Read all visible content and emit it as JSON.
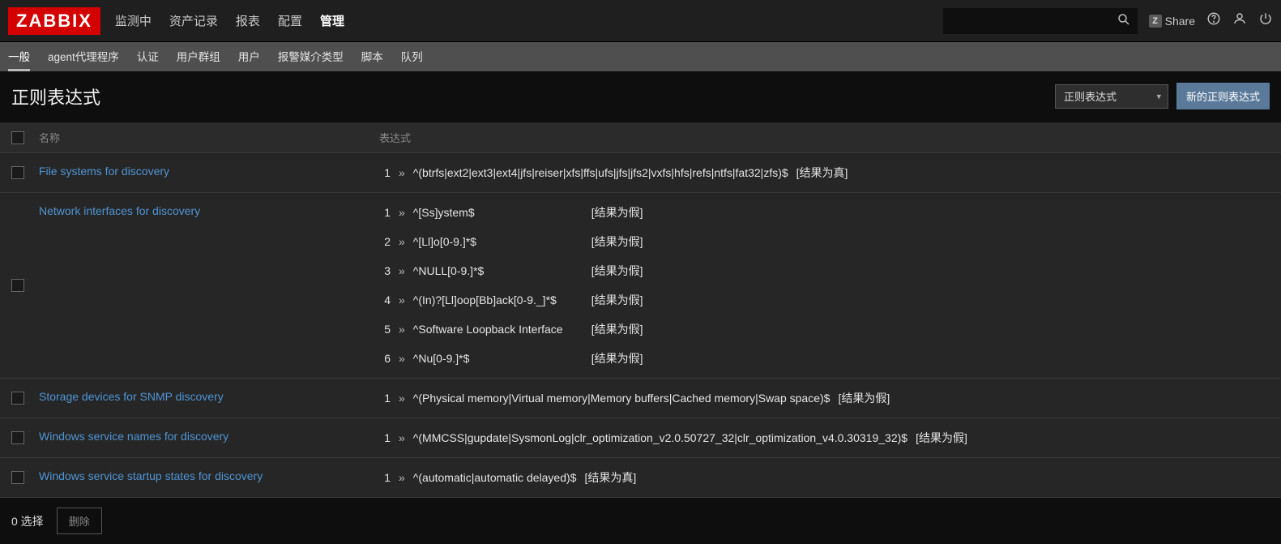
{
  "brand": "ZABBIX",
  "topmenu": {
    "items": [
      {
        "label": "监测中"
      },
      {
        "label": "资产记录"
      },
      {
        "label": "报表"
      },
      {
        "label": "配置"
      },
      {
        "label": "管理",
        "active": true
      }
    ]
  },
  "share_label": "Share",
  "submenu": {
    "items": [
      {
        "label": "一般",
        "active": true
      },
      {
        "label": "agent代理程序"
      },
      {
        "label": "认证"
      },
      {
        "label": "用户群组"
      },
      {
        "label": "用户"
      },
      {
        "label": "报警媒介类型"
      },
      {
        "label": "脚本"
      },
      {
        "label": "队列"
      }
    ]
  },
  "page": {
    "title": "正则表达式",
    "dropdown_selected": "正则表达式",
    "new_button": "新的正则表达式"
  },
  "table": {
    "headers": {
      "name": "名称",
      "expr": "表达式"
    },
    "rows": [
      {
        "name": "File systems for discovery",
        "exprs": [
          {
            "n": "1",
            "pattern": "^(btrfs|ext2|ext3|ext4|jfs|reiser|xfs|ffs|ufs|jfs|jfs2|vxfs|hfs|refs|ntfs|fat32|zfs)$",
            "result": "[结果为真]"
          }
        ]
      },
      {
        "name": "Network interfaces for discovery",
        "exprs": [
          {
            "n": "1",
            "pattern": "^[Ss]ystem$",
            "result": "[结果为假]"
          },
          {
            "n": "2",
            "pattern": "^[Ll]o[0-9.]*$",
            "result": "[结果为假]"
          },
          {
            "n": "3",
            "pattern": "^NULL[0-9.]*$",
            "result": "[结果为假]"
          },
          {
            "n": "4",
            "pattern": "^(In)?[Ll]oop[Bb]ack[0-9._]*$",
            "result": "[结果为假]"
          },
          {
            "n": "5",
            "pattern": "^Software Loopback Interface",
            "result": "[结果为假]"
          },
          {
            "n": "6",
            "pattern": "^Nu[0-9.]*$",
            "result": "[结果为假]"
          }
        ]
      },
      {
        "name": "Storage devices for SNMP discovery",
        "exprs": [
          {
            "n": "1",
            "pattern": "^(Physical memory|Virtual memory|Memory buffers|Cached memory|Swap space)$",
            "result": "[结果为假]"
          }
        ]
      },
      {
        "name": "Windows service names for discovery",
        "exprs": [
          {
            "n": "1",
            "pattern": "^(MMCSS|gupdate|SysmonLog|clr_optimization_v2.0.50727_32|clr_optimization_v4.0.30319_32)$",
            "result": "[结果为假]"
          }
        ]
      },
      {
        "name": "Windows service startup states for discovery",
        "exprs": [
          {
            "n": "1",
            "pattern": "^(automatic|automatic delayed)$",
            "result": "[结果为真]"
          }
        ]
      }
    ]
  },
  "footer": {
    "selected_text": "0 选择",
    "delete_label": "删除"
  }
}
